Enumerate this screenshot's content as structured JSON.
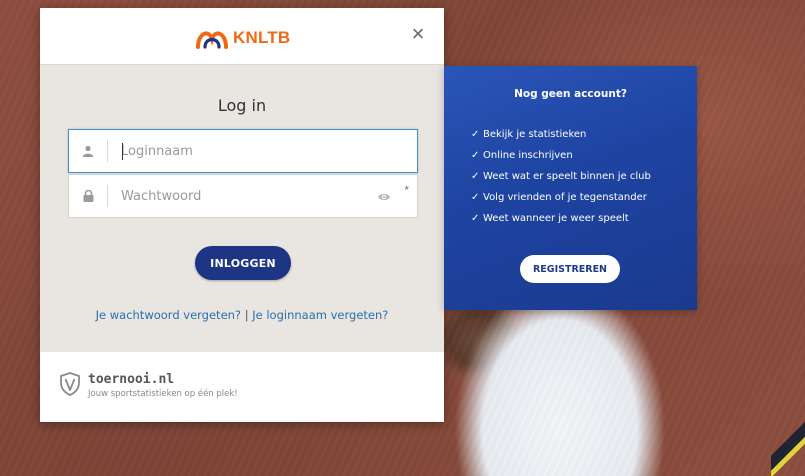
{
  "modal": {
    "logo_text": "KNLTB",
    "close_label": "×",
    "title": "Log in",
    "username": {
      "placeholder": "Loginnaam",
      "value": ""
    },
    "password": {
      "placeholder": "Wachtwoord",
      "value": "",
      "required_mark": "*"
    },
    "login_button": "INLOGGEN",
    "forgot_password": "Je wachtwoord vergeten?",
    "separator": "|",
    "forgot_username": "Je loginnaam vergeten?",
    "footer": {
      "brand": "toernooi.nl",
      "tagline": "Jouw sportstatistieken op één plek!"
    }
  },
  "promo": {
    "title": "Nog geen account?",
    "check_glyph": "✓",
    "items": [
      "Bekijk je statistieken",
      "Online inschrijven",
      "Weet wat er speelt binnen je club",
      "Volg vrienden of je tegenstander",
      "Weet wanneer je weer speelt"
    ],
    "register_button": "REGISTREREN"
  },
  "colors": {
    "brand_orange": "#f06a14",
    "primary_blue": "#1e3484",
    "promo_blue": "#1e44a2",
    "link_blue": "#2a6fb0"
  },
  "icons": [
    "user-icon",
    "lock-icon",
    "eye-icon",
    "close-icon",
    "shield-icon",
    "checkmark-icon"
  ]
}
